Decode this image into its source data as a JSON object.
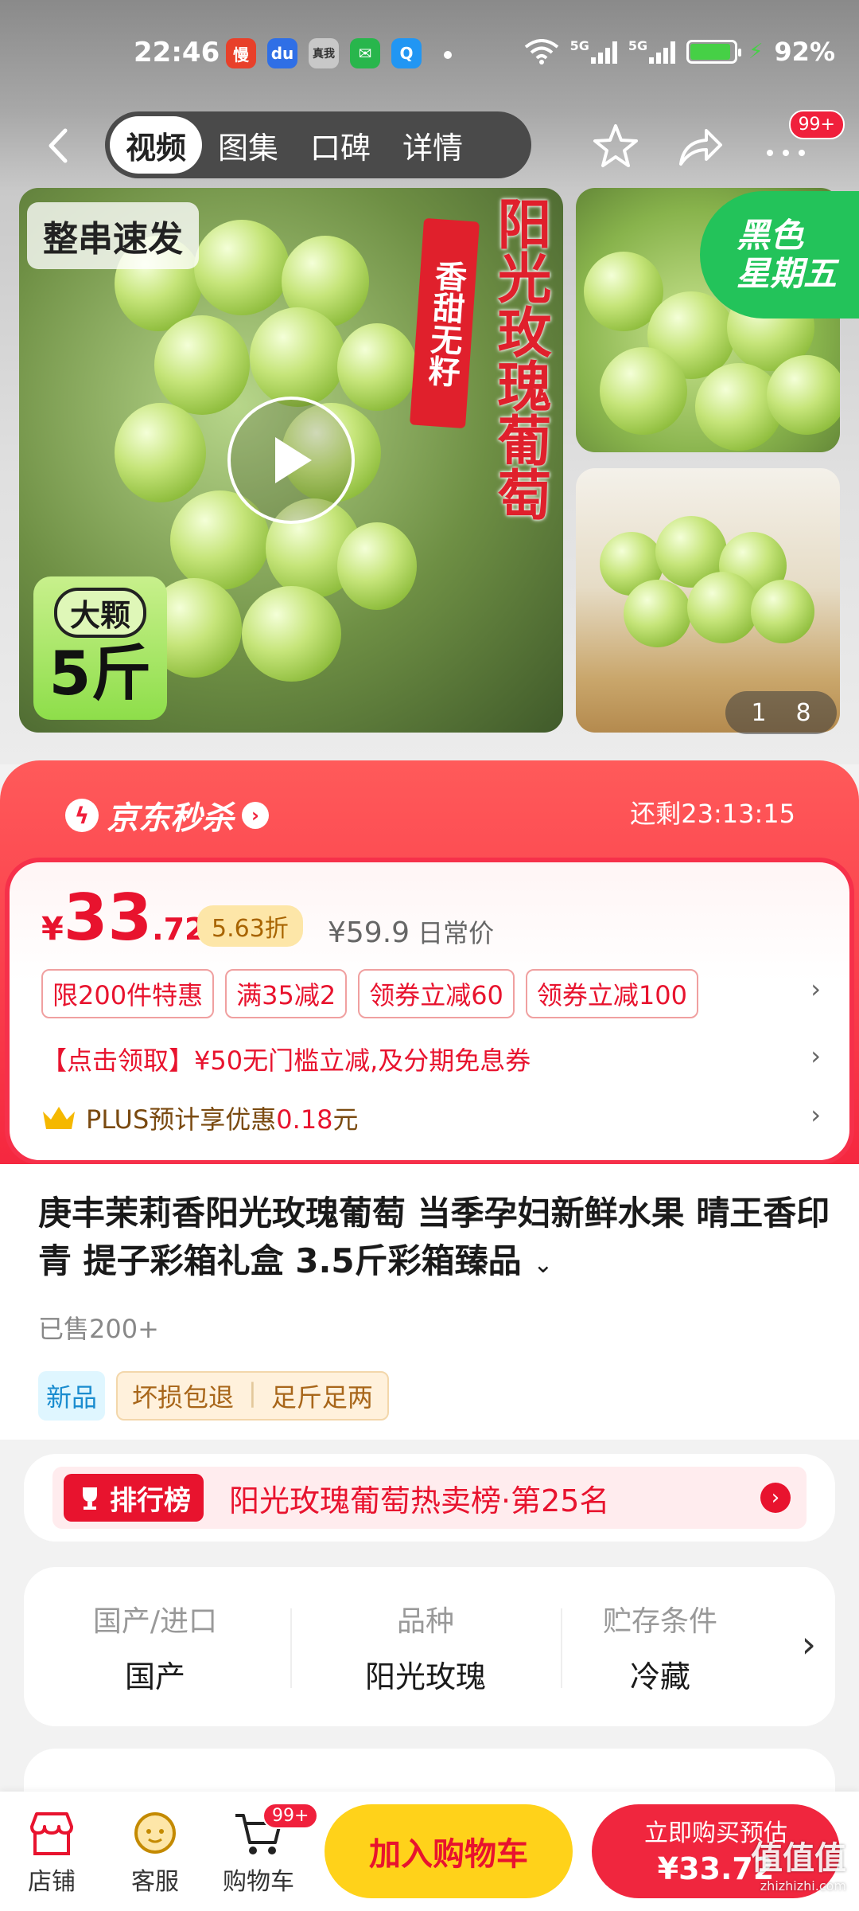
{
  "status_bar": {
    "time": "22:46",
    "apps": [
      {
        "name": "慢",
        "color": "#e8402a"
      },
      {
        "name": "du",
        "color": "#2f6fe6"
      },
      {
        "name": "真我",
        "color": "#c8c8c8"
      },
      {
        "name": "✉",
        "color": "#28b64c"
      },
      {
        "name": "Q",
        "color": "#2196f3"
      }
    ],
    "signal1": "5G",
    "signal2": "5G",
    "battery": "92%"
  },
  "nav": {
    "tabs": [
      "视频",
      "图集",
      "口碑",
      "详情"
    ],
    "active_tab": 0,
    "more_badge": "99+"
  },
  "gallery": {
    "chip": "整串速发",
    "title": "阳光玫瑰葡萄",
    "subtitle": "香甜无籽",
    "size_pill": "大颗",
    "weight": "5斤",
    "promo": [
      "黑色",
      "星期五"
    ],
    "page_current": "1",
    "page_total": "8"
  },
  "seckill": {
    "title": "京东秒杀",
    "remaining_label": "还剩",
    "remaining_time": "23:13:15",
    "price_currency": "¥",
    "price_int": "33",
    "price_dec": ".72",
    "discount": "5.63折",
    "original_price": "¥59.9",
    "original_label": "日常价",
    "coupons": [
      "限200件特惠",
      "满35减2",
      "领券立减60",
      "领券立减100"
    ],
    "claim_text": "【点击领取】¥50无门槛立减,及分期免息券",
    "plus_prefix": "PLUS预计享优惠",
    "plus_amount": "0.18",
    "plus_unit": "元"
  },
  "product": {
    "title": "庚丰茉莉香阳光玫瑰葡萄 当季孕妇新鲜水果 晴王香印青 提子彩箱礼盒 3.5斤彩箱臻品",
    "sold": "已售200+",
    "tag_new": "新品",
    "service_tags": [
      "坏损包退",
      "足斤足两"
    ]
  },
  "rank": {
    "badge": "排行榜",
    "text": "阳光玫瑰葡萄热卖榜·第25名"
  },
  "attributes": [
    {
      "key": "国产/进口",
      "value": "国产"
    },
    {
      "key": "品种",
      "value": "阳光玫瑰"
    },
    {
      "key": "贮存条件",
      "value": "冷藏"
    }
  ],
  "bottom_bar": {
    "store": "店铺",
    "service": "客服",
    "cart": "购物车",
    "cart_badge": "99+",
    "add_to_cart": "加入购物车",
    "buy_label": "立即购买预估",
    "buy_price": "¥33.72"
  },
  "watermark": {
    "main": "值值值",
    "sub": "zhizhizhi.com"
  }
}
